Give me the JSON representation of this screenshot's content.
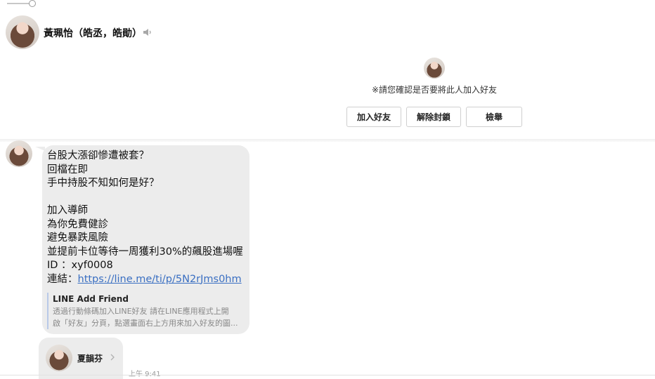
{
  "header": {
    "name": "黃珮怡（皓丞，皓勛）",
    "speaker_icon": "speaker-icon"
  },
  "confirm": {
    "text": "※請您確認是否要將此人加入好友",
    "buttons": {
      "add_friend": "加入好友",
      "unblock": "解除封鎖",
      "report": "檢舉"
    }
  },
  "message": {
    "lines": [
      "台股大漲卻慘遭被套？",
      "回檔在即",
      "手中持股不知如何是好？",
      "",
      "加入導師",
      "為你免費健診",
      "避免暴跌風險",
      "並提前卡位等待一周獲利30%的飆股進場喔",
      "ID ：xyf0008"
    ],
    "link_prefix": "連結：",
    "link_text": "https://line.me/ti/p/5N2rJms0hm",
    "preview": {
      "title": "LINE Add Friend",
      "desc_line1": "透過行動條碼加入LINE好友 請在LINE應用程式上開",
      "desc_line2": "啟「好友」分頁，點選畫面右上方用來加入好友的圖..."
    }
  },
  "contact_card": {
    "name": "夏韻芬"
  },
  "timestamp": "上午 9:41",
  "colors": {
    "bubble": "#ececec",
    "link": "#3a6fc2",
    "preview_bar": "#b8c9e8"
  }
}
